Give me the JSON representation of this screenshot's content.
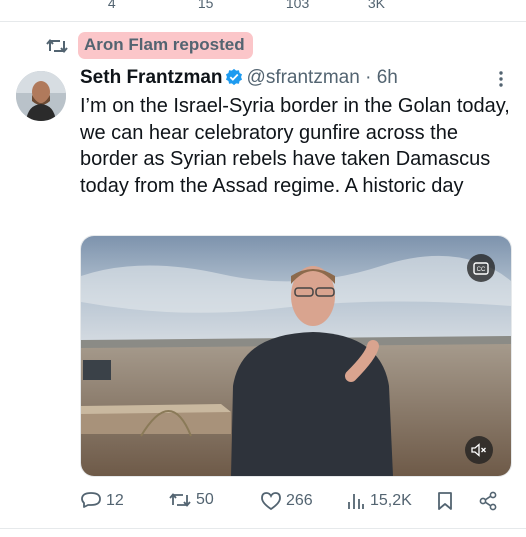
{
  "previous_tweet": {
    "reply_count": "4",
    "repost_count": "15",
    "like_count": "103",
    "view_count": "3K"
  },
  "repost_banner": {
    "text": "Aron Flam reposted"
  },
  "tweet": {
    "author_name": "Seth Frantzman",
    "author_handle": "@sfrantzman",
    "separator": "·",
    "time": "6h",
    "text": "I’m on the Israel-Syria border in the Golan today, we can hear celebratory gunfire across the border as Syrian rebels have taken Damascus today from the Assad regime. A historic day",
    "media": {
      "type": "video",
      "cc_icon": "closed-captions-icon",
      "mute_icon": "volume-muted-icon"
    },
    "actions": {
      "replies": "12",
      "reposts": "50",
      "likes": "266",
      "views": "15,2K"
    }
  },
  "colors": {
    "highlight": "#fbc6c9",
    "verified": "#1d9bf0",
    "muted_text": "#536471",
    "text": "#0f1419"
  }
}
